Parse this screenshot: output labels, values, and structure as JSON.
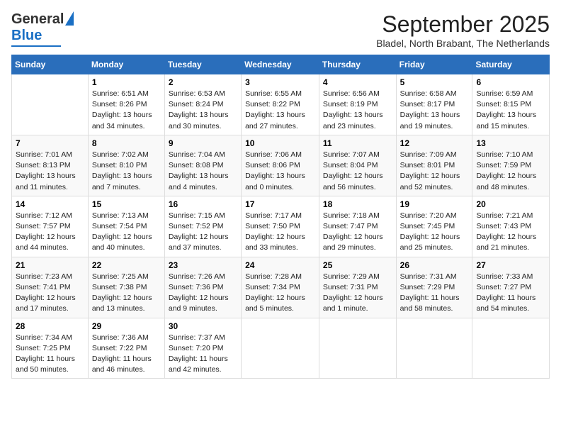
{
  "logo": {
    "general": "General",
    "blue": "Blue"
  },
  "header": {
    "month": "September 2025",
    "location": "Bladel, North Brabant, The Netherlands"
  },
  "weekdays": [
    "Sunday",
    "Monday",
    "Tuesday",
    "Wednesday",
    "Thursday",
    "Friday",
    "Saturday"
  ],
  "weeks": [
    [
      {
        "day": "",
        "content": ""
      },
      {
        "day": "1",
        "content": "Sunrise: 6:51 AM\nSunset: 8:26 PM\nDaylight: 13 hours\nand 34 minutes."
      },
      {
        "day": "2",
        "content": "Sunrise: 6:53 AM\nSunset: 8:24 PM\nDaylight: 13 hours\nand 30 minutes."
      },
      {
        "day": "3",
        "content": "Sunrise: 6:55 AM\nSunset: 8:22 PM\nDaylight: 13 hours\nand 27 minutes."
      },
      {
        "day": "4",
        "content": "Sunrise: 6:56 AM\nSunset: 8:19 PM\nDaylight: 13 hours\nand 23 minutes."
      },
      {
        "day": "5",
        "content": "Sunrise: 6:58 AM\nSunset: 8:17 PM\nDaylight: 13 hours\nand 19 minutes."
      },
      {
        "day": "6",
        "content": "Sunrise: 6:59 AM\nSunset: 8:15 PM\nDaylight: 13 hours\nand 15 minutes."
      }
    ],
    [
      {
        "day": "7",
        "content": "Sunrise: 7:01 AM\nSunset: 8:13 PM\nDaylight: 13 hours\nand 11 minutes."
      },
      {
        "day": "8",
        "content": "Sunrise: 7:02 AM\nSunset: 8:10 PM\nDaylight: 13 hours\nand 7 minutes."
      },
      {
        "day": "9",
        "content": "Sunrise: 7:04 AM\nSunset: 8:08 PM\nDaylight: 13 hours\nand 4 minutes."
      },
      {
        "day": "10",
        "content": "Sunrise: 7:06 AM\nSunset: 8:06 PM\nDaylight: 13 hours\nand 0 minutes."
      },
      {
        "day": "11",
        "content": "Sunrise: 7:07 AM\nSunset: 8:04 PM\nDaylight: 12 hours\nand 56 minutes."
      },
      {
        "day": "12",
        "content": "Sunrise: 7:09 AM\nSunset: 8:01 PM\nDaylight: 12 hours\nand 52 minutes."
      },
      {
        "day": "13",
        "content": "Sunrise: 7:10 AM\nSunset: 7:59 PM\nDaylight: 12 hours\nand 48 minutes."
      }
    ],
    [
      {
        "day": "14",
        "content": "Sunrise: 7:12 AM\nSunset: 7:57 PM\nDaylight: 12 hours\nand 44 minutes."
      },
      {
        "day": "15",
        "content": "Sunrise: 7:13 AM\nSunset: 7:54 PM\nDaylight: 12 hours\nand 40 minutes."
      },
      {
        "day": "16",
        "content": "Sunrise: 7:15 AM\nSunset: 7:52 PM\nDaylight: 12 hours\nand 37 minutes."
      },
      {
        "day": "17",
        "content": "Sunrise: 7:17 AM\nSunset: 7:50 PM\nDaylight: 12 hours\nand 33 minutes."
      },
      {
        "day": "18",
        "content": "Sunrise: 7:18 AM\nSunset: 7:47 PM\nDaylight: 12 hours\nand 29 minutes."
      },
      {
        "day": "19",
        "content": "Sunrise: 7:20 AM\nSunset: 7:45 PM\nDaylight: 12 hours\nand 25 minutes."
      },
      {
        "day": "20",
        "content": "Sunrise: 7:21 AM\nSunset: 7:43 PM\nDaylight: 12 hours\nand 21 minutes."
      }
    ],
    [
      {
        "day": "21",
        "content": "Sunrise: 7:23 AM\nSunset: 7:41 PM\nDaylight: 12 hours\nand 17 minutes."
      },
      {
        "day": "22",
        "content": "Sunrise: 7:25 AM\nSunset: 7:38 PM\nDaylight: 12 hours\nand 13 minutes."
      },
      {
        "day": "23",
        "content": "Sunrise: 7:26 AM\nSunset: 7:36 PM\nDaylight: 12 hours\nand 9 minutes."
      },
      {
        "day": "24",
        "content": "Sunrise: 7:28 AM\nSunset: 7:34 PM\nDaylight: 12 hours\nand 5 minutes."
      },
      {
        "day": "25",
        "content": "Sunrise: 7:29 AM\nSunset: 7:31 PM\nDaylight: 12 hours\nand 1 minute."
      },
      {
        "day": "26",
        "content": "Sunrise: 7:31 AM\nSunset: 7:29 PM\nDaylight: 11 hours\nand 58 minutes."
      },
      {
        "day": "27",
        "content": "Sunrise: 7:33 AM\nSunset: 7:27 PM\nDaylight: 11 hours\nand 54 minutes."
      }
    ],
    [
      {
        "day": "28",
        "content": "Sunrise: 7:34 AM\nSunset: 7:25 PM\nDaylight: 11 hours\nand 50 minutes."
      },
      {
        "day": "29",
        "content": "Sunrise: 7:36 AM\nSunset: 7:22 PM\nDaylight: 11 hours\nand 46 minutes."
      },
      {
        "day": "30",
        "content": "Sunrise: 7:37 AM\nSunset: 7:20 PM\nDaylight: 11 hours\nand 42 minutes."
      },
      {
        "day": "",
        "content": ""
      },
      {
        "day": "",
        "content": ""
      },
      {
        "day": "",
        "content": ""
      },
      {
        "day": "",
        "content": ""
      }
    ]
  ]
}
